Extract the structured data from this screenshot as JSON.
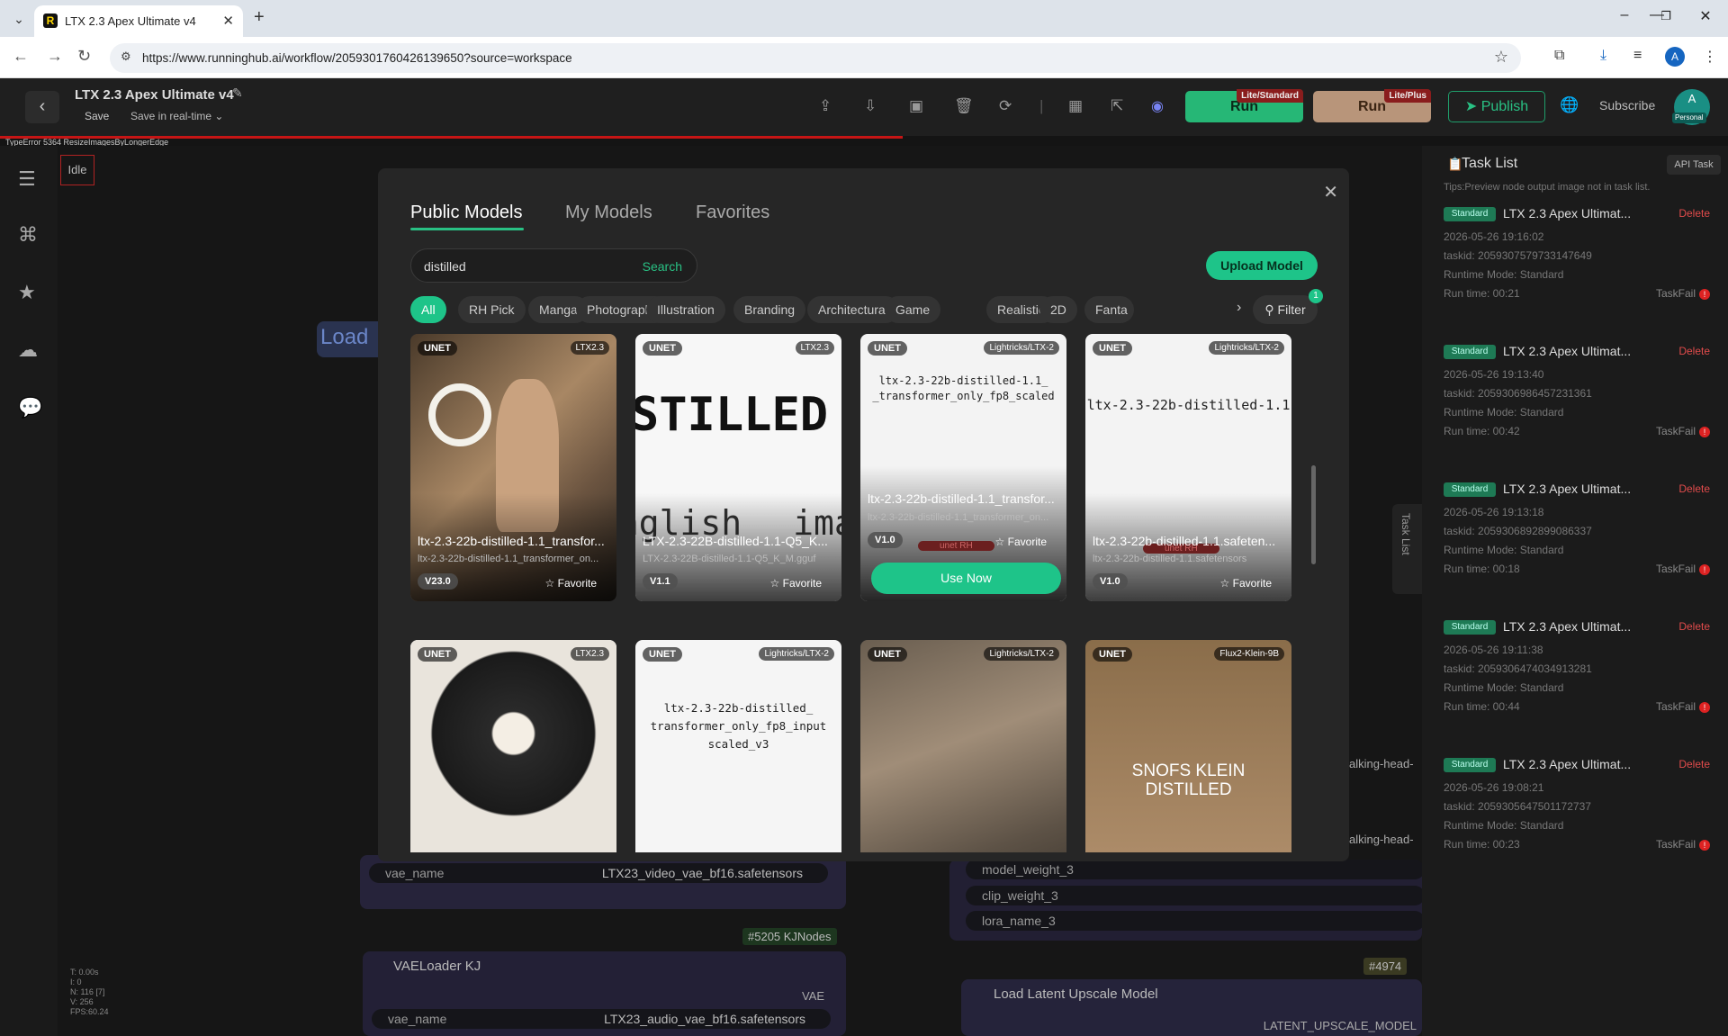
{
  "browser": {
    "tab_title": "LTX 2.3 Apex Ultimate v4",
    "url": "https://www.runninghub.ai/workflow/2059301760426139650?source=workspace",
    "profile_initial": "A"
  },
  "header": {
    "title": "LTX 2.3 Apex Ultimate v4",
    "save": "Save",
    "save_mode": "Save in real-time",
    "run1_label": "Run",
    "run1_tag": "Lite/Standard",
    "run2_label": "Run",
    "run2_tag": "Lite/Plus",
    "publish": "Publish",
    "subscribe": "Subscribe",
    "avatar_initial": "A",
    "avatar_badge": "Personal"
  },
  "error": {
    "text": "TypeError 5364 ResizeImagesByLongerEdge"
  },
  "canvas": {
    "status": "Idle",
    "load_title": "Load",
    "vae_name_label": "vae_name",
    "vae_video": "LTX23_video_vae_bf16.safetensors",
    "vae_audio": "LTX23_audio_vae_bf16.safetensors",
    "kj_tag": "#5205 KJNodes",
    "vae_loader_kj": "VAELoader KJ",
    "vae_port": "VAE",
    "node_4974": "#4974",
    "load_latent": "Load Latent Upscale Model",
    "latent_port": "LATENT_UPSCALE_MODEL",
    "model_weight_3": "model_weight_3",
    "clip_weight_3": "clip_weight_3",
    "lora_name_3": "lora_name_3",
    "talking1": "alking-head-",
    "talking2": "alking-head-",
    "stats": [
      "T: 0.00s",
      "I: 0",
      "N: 116 [7]",
      "V: 256",
      "FPS:60.24"
    ]
  },
  "tasklist": {
    "title": "Task List",
    "api": "API Task",
    "tips": "Tips:Preview node output image not in task list.",
    "side_tab": "Task List",
    "tasks": [
      {
        "badge": "Standard",
        "name": "LTX 2.3 Apex Ultimat...",
        "delete": "Delete",
        "time": "2026-05-26 19:16:02",
        "taskid": "taskid: 2059307579733147649",
        "mode": "Runtime Mode: Standard",
        "runtime": "Run time: 00:21",
        "status": "TaskFail"
      },
      {
        "badge": "Standard",
        "name": "LTX 2.3 Apex Ultimat...",
        "delete": "Delete",
        "time": "2026-05-26 19:13:40",
        "taskid": "taskid: 2059306986457231361",
        "mode": "Runtime Mode: Standard",
        "runtime": "Run time: 00:42",
        "status": "TaskFail"
      },
      {
        "badge": "Standard",
        "name": "LTX 2.3 Apex Ultimat...",
        "delete": "Delete",
        "time": "2026-05-26 19:13:18",
        "taskid": "taskid: 2059306892899086337",
        "mode": "Runtime Mode: Standard",
        "runtime": "Run time: 00:18",
        "status": "TaskFail"
      },
      {
        "badge": "Standard",
        "name": "LTX 2.3 Apex Ultimat...",
        "delete": "Delete",
        "time": "2026-05-26 19:11:38",
        "taskid": "taskid: 2059306474034913281",
        "mode": "Runtime Mode: Standard",
        "runtime": "Run time: 00:44",
        "status": "TaskFail"
      },
      {
        "badge": "Standard",
        "name": "LTX 2.3 Apex Ultimat...",
        "delete": "Delete",
        "time": "2026-05-26 19:08:21",
        "taskid": "taskid: 2059305647501172737",
        "mode": "Runtime Mode: Standard",
        "runtime": "Run time: 00:23",
        "status": "TaskFail"
      }
    ]
  },
  "modal": {
    "tabs": [
      "Public Models",
      "My Models",
      "Favorites"
    ],
    "search_value": "distilled",
    "search_btn": "Search",
    "upload": "Upload Model",
    "chips": [
      "All",
      "RH Pick",
      "Manga",
      "Photography",
      "Illustration",
      "Branding",
      "Architectural",
      "Game",
      "Realistic",
      "2D",
      "Fanta"
    ],
    "filter": "Filter",
    "filter_count": "1",
    "cards": [
      {
        "type": "UNET",
        "base": "LTX2.3",
        "name": "ltx-2.3-22b-distilled-1.1_transfor...",
        "file": "ltx-2.3-22b-distilled-1.1_transformer_on...",
        "version": "V23.0",
        "fav": "Favorite"
      },
      {
        "type": "UNET",
        "base": "LTX2.3",
        "name": "LTX-2.3-22B-distilled-1.1-Q5_K...",
        "file": "LTX-2.3-22B-distilled-1.1-Q5_K_M.gguf",
        "version": "V1.1",
        "fav": "Favorite",
        "art1": "STILLED",
        "art2": "nglish",
        "art3": "ima"
      },
      {
        "type": "UNET",
        "base": "Lightricks/LTX-2",
        "name": "ltx-2.3-22b-distilled-1.1_transfor...",
        "file": "ltx-2.3-22b-distilled-1.1_transformer_on...",
        "version": "V1.0",
        "fav": "Favorite",
        "use": "Use Now",
        "art1": "ltx-2.3-22b-distilled-1.1_",
        "art2": "_transformer_only_fp8_scaled",
        "mini": "unet RH"
      },
      {
        "type": "UNET",
        "base": "Lightricks/LTX-2",
        "name": "ltx-2.3-22b-distilled-1.1.safeten...",
        "file": "ltx-2.3-22b-distilled-1.1.safetensors",
        "version": "V1.0",
        "fav": "Favorite",
        "art1": "ltx-2.3-22b-distilled-1.1",
        "mini": "unet RH"
      },
      {
        "type": "UNET",
        "base": "LTX2.3"
      },
      {
        "type": "UNET",
        "base": "Lightricks/LTX-2",
        "art1": "ltx-2.3-22b-distilled_",
        "art2": "transformer_only_fp8_input",
        "art3": "scaled_v3"
      },
      {
        "type": "UNET",
        "base": "Lightricks/LTX-2"
      },
      {
        "type": "UNET",
        "base": "Flux2-Klein-9B",
        "art1": "SNOFS KLEIN",
        "art2": "DISTILLED"
      }
    ]
  }
}
